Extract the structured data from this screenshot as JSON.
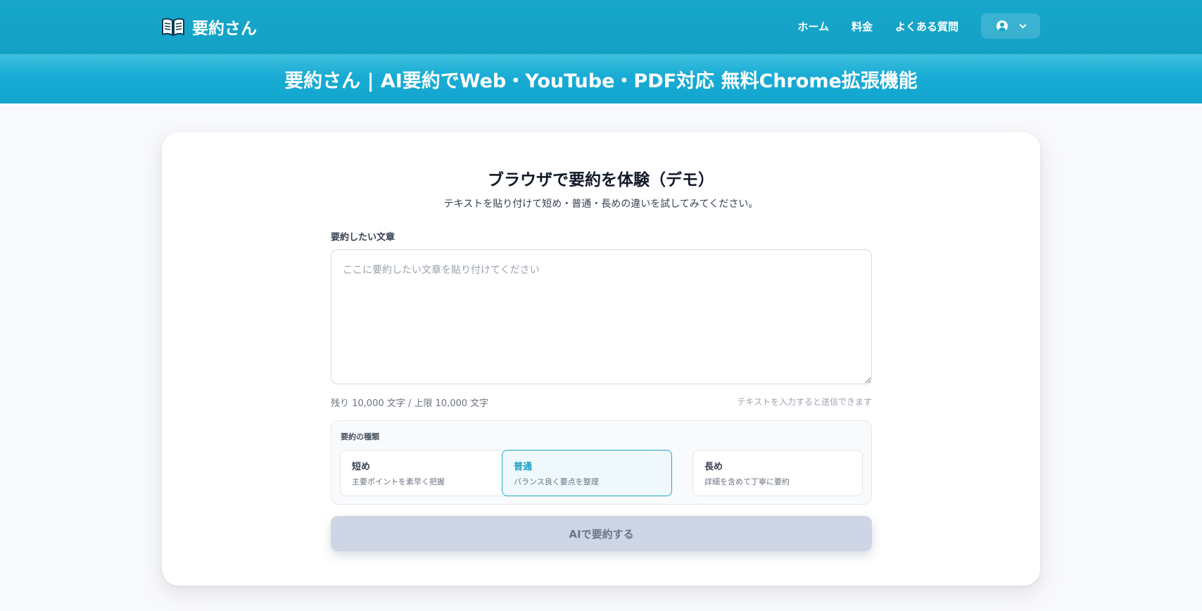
{
  "header": {
    "brand_name": "要約さん",
    "nav": [
      "ホーム",
      "料金",
      "よくある質問"
    ],
    "user_icon": "user-circle-icon",
    "dropdown_icon": "chevron-down-icon"
  },
  "title_band": {
    "title": "要約さん | AI要約でWeb・YouTube・PDF対応 無料Chrome拡張機能"
  },
  "demo": {
    "title": "ブラウザで要約を体験（デモ）",
    "subtitle": "テキストを貼り付けて短め・普通・長めの違いを試してみてください。",
    "input_label": "要約したい文章",
    "input_placeholder": "ここに要約したい文章を貼り付けてください",
    "input_value": "",
    "count_text": "残り 10,000 文字 / 上限 10,000 文字",
    "hint_text": "テキストを入力すると送信できます",
    "type_label": "要約の種類",
    "options": [
      {
        "title": "短め",
        "desc": "主要ポイントを素早く把握"
      },
      {
        "title": "普通",
        "desc": "バランス良く要点を整理"
      },
      {
        "title": "長め",
        "desc": "詳細を含めて丁寧に要約"
      }
    ],
    "selected_option": "普通",
    "submit_label": "AIで要約する"
  },
  "colors": {
    "header": "#17a7cb",
    "accent": "#1a9fc2",
    "button_disabled": "#ced5e4"
  }
}
